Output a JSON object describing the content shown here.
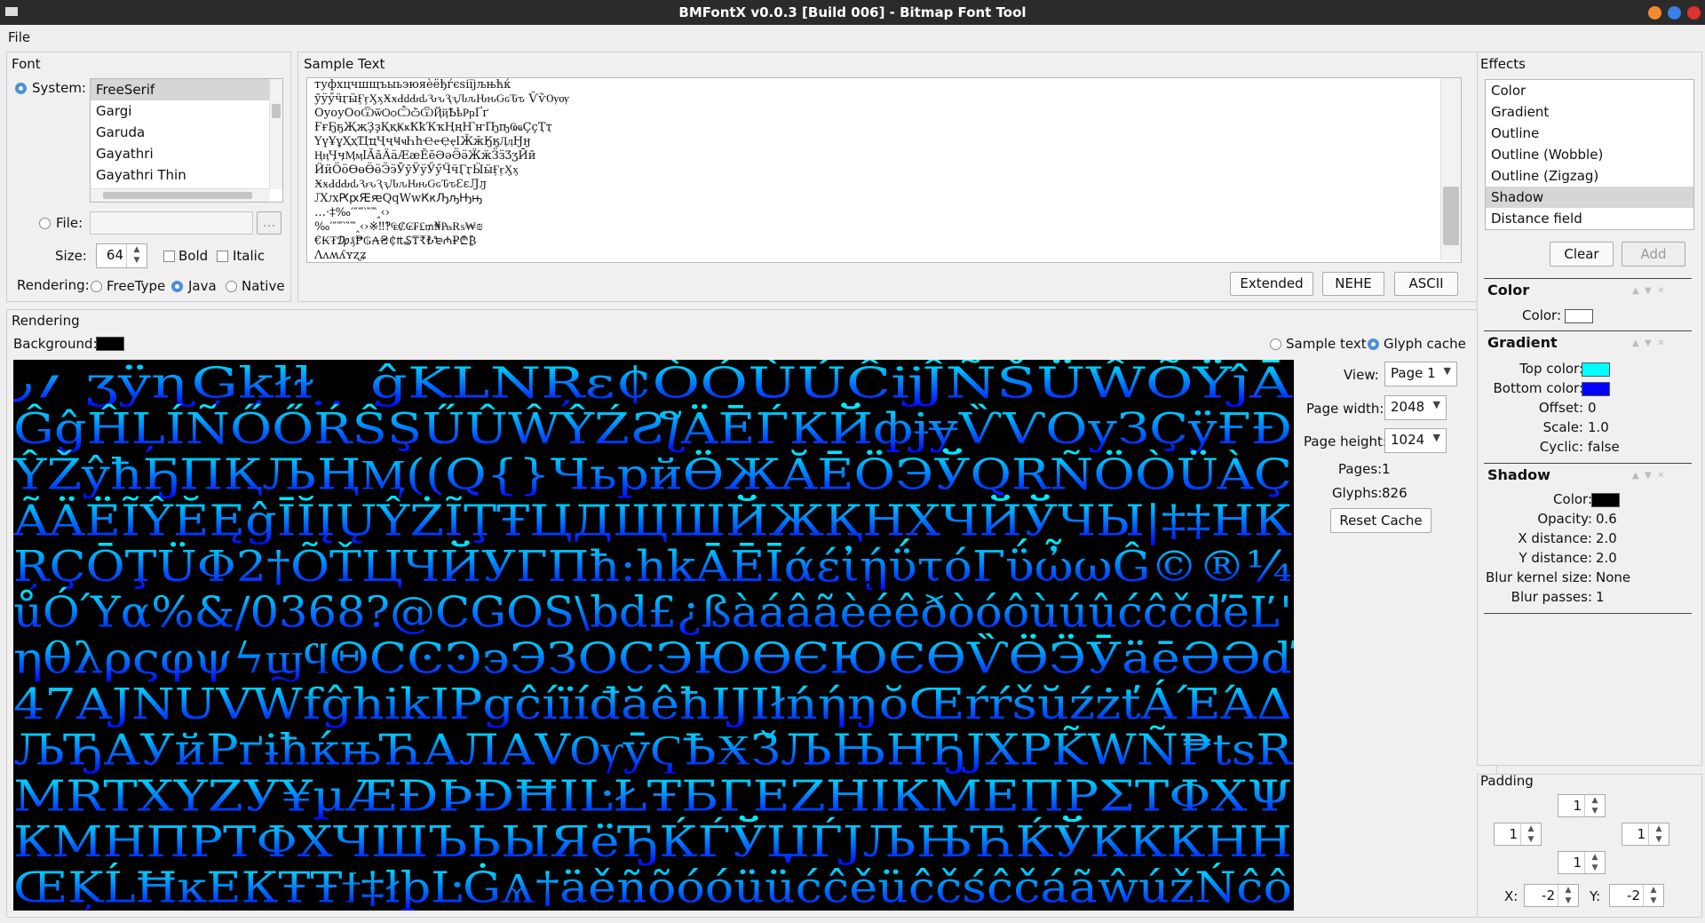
{
  "window": {
    "title": "BMFontX v0.0.3 [Build 006] - Bitmap Font Tool"
  },
  "menu": {
    "file": "File"
  },
  "font": {
    "group_title": "Font",
    "system_label": "System:",
    "fonts": [
      "FreeSerif",
      "Gargi",
      "Garuda",
      "Gayathri",
      "Gayathri Thin"
    ],
    "selected_font": "FreeSerif",
    "file_label": "File:",
    "file_value": "",
    "browse_label": "...",
    "size_label": "Size:",
    "size_value": "64",
    "bold_label": "Bold",
    "italic_label": "Italic",
    "rendering_label": "Rendering:",
    "rendering_options": [
      "FreeType",
      "Java",
      "Native"
    ],
    "rendering_selected": "Java"
  },
  "sample_text": {
    "group_title": "Sample Text",
    "lines": [
      "туфхцчшщъыьэюяѐёђѓєѕіїјљњћќ",
      "ӯӱӳӵӷӹӺӻӼӽӾӿԀԁԂԃԄԅԆԇԈԉԊԋԌԍԎԏ ѶѷѸѹ",
      "ОуоуОоѾѿѺѻѼѽѾҊҋҌҍҎҏҐґ",
      "ҒғҔҕҖҗҘҙҚқҜҝҞҟҠҡҢңҤҥҦҧҨҩҪҫҬҭ",
      "ҮүҰұҲҳҴҵҶҷҸҹҺһҼҽҾҿӀӁӂӃӄӅӆӇӈ",
      "ӉӊӋӌӍӎӏӐӑӒӓӔӕӖӗӘәӚӛӜӝӞӟӠӡӢӣ",
      "ӤӥӦӧӨөӪӫӬӭӮӯӰӱӲӳӴӵӶӷӸӹӺӻӼӽ",
      "ӾӿԀԁԂԃԄԅԆԇԈԉԊԋԌԍԎԏԐԑԒԓ",
      "ԔԕԖԗԘԙԚԛԜԝԞԟԠԡԢԣ",
      "…‧‡‰′″‴‵‶‷‸‹›",
      "‰′″‴‵‶‷‸‹›※‼‽₠₡₢₣₤₥₦₧₨₩₪",
      "€₭₮₯₰₱₲₳₴₵₶₷₸₹₺₻₼₽₾₿",
      "Ʌʌʍʎʏʐʑ"
    ],
    "buttons": {
      "extended": "Extended",
      "nehe": "NEHE",
      "ascii": "ASCII"
    }
  },
  "rendering": {
    "group_title": "Rendering",
    "background_label": "Background:",
    "background_color": "#000000",
    "mode_options": [
      "Sample text",
      "Glyph cache"
    ],
    "mode_selected": "Glyph cache",
    "view_label": "View:",
    "view_value": "Page 1",
    "page_width_label": "Page width:",
    "page_width_value": "2048",
    "page_height_label": "Page height:",
    "page_height_value": "1024",
    "pages_label": "Pages:",
    "pages_value": "1",
    "glyphs_label": "Glyphs:",
    "glyphs_value": "826",
    "reset_cache_label": "Reset Cache",
    "glyph_rows": [
      "  ؍٫   ʒÿɳĢķłɫ  ̣  ̣  ĝKLNŖɛ₵ÒÓÙÚĈĳĴÑŠÜŴÕŸĵĀ",
      "ĜĝĤĻÍÑŐŐŔŜŞŰÛŴŶŹƧƪÄĒЃКЙфɉɏѶѴОуЗÇÿҒÐ",
      "ŶŽŷħҔΠҚЉҢӍ((Q{}ЧьрйӪЖĂĒÖЭЎQRÑÖÒÜÀÇ",
      "ÃÄËĨŶĔĘĝĪĬĮŲŶŻĨŢŦЦДЩШЙЖҚНХЧЙЎЧЫ|‡‡НК",
      "ŖÇŌŢÜΦ2†ÕŤЦЧЙУГПħ:hkĀĒĪάέἰῄΰτόΓΰὦωĜ©®¼",
      "ůÓΎα%&/0368?@CGOS\\bd£¿ßàáâãèéêðòóôùúûćĉčďēĽ'",
      "ηθλρςφψϟϣϥΘϹϾϿ϶ЭЗОСЭЮӨЄЮЄӨѶӪӬӮäēӘӘď",
      "47AJNUVWfĝhikIPgĉíïíđăêħIJIłńήŋŏŒŕŕšŭźżťÁΈΆΔ",
      "ЉЂАУйРґɨħќњЋАЛАVѸӯҀҌӾЗ̌ЉЊНЂJXPK̃WÑ₱tsR",
      "MRTXYZУ¥µÆÐÞÐĦIĿŁŦБГЕZНІКМЕПРΣΤΦΧΨ",
      "КМНПРТФХЧШЪЬЫЯёЂЌЃЎЏЃЈЉЊЋЌЎКККНН",
      "ŒĶĹĦĸЕКŦŦϯ‡łþĿĠѦ†äěñõóóüüćĉěüĉčśĉčáãŵúžŃĉô"
    ]
  },
  "effects": {
    "group_title": "Effects",
    "items": [
      "Color",
      "Gradient",
      "Outline",
      "Outline (Wobble)",
      "Outline (Zigzag)",
      "Shadow",
      "Distance field"
    ],
    "selected": "Shadow",
    "clear_label": "Clear",
    "add_label": "Add",
    "color_section": {
      "title": "Color",
      "color_label": "Color:",
      "color": "#ffffff"
    },
    "gradient_section": {
      "title": "Gradient",
      "top_label": "Top color:",
      "top_color": "#00ffff",
      "bottom_label": "Bottom color:",
      "bottom_color": "#0000ff",
      "offset_label": "Offset:",
      "offset_value": "0",
      "scale_label": "Scale:",
      "scale_value": "1.0",
      "cyclic_label": "Cyclic:",
      "cyclic_value": "false"
    },
    "shadow_section": {
      "title": "Shadow",
      "color_label": "Color:",
      "color": "#000000",
      "opacity_label": "Opacity:",
      "opacity_value": "0.6",
      "xdist_label": "X distance:",
      "xdist_value": "2.0",
      "ydist_label": "Y distance:",
      "ydist_value": "2.0",
      "blur_kernel_label": "Blur kernel size:",
      "blur_kernel_value": "None",
      "blur_passes_label": "Blur passes:",
      "blur_passes_value": "1"
    }
  },
  "padding": {
    "group_title": "Padding",
    "top": "1",
    "left": "1",
    "right": "1",
    "bottom": "1",
    "x_label": "X:",
    "x_value": "-2",
    "y_label": "Y:",
    "y_value": "-2"
  },
  "colors": {
    "accent": "#4a90d9",
    "win_min": "#f28b30",
    "win_max": "#3a7ee8",
    "win_close": "#e03030"
  }
}
